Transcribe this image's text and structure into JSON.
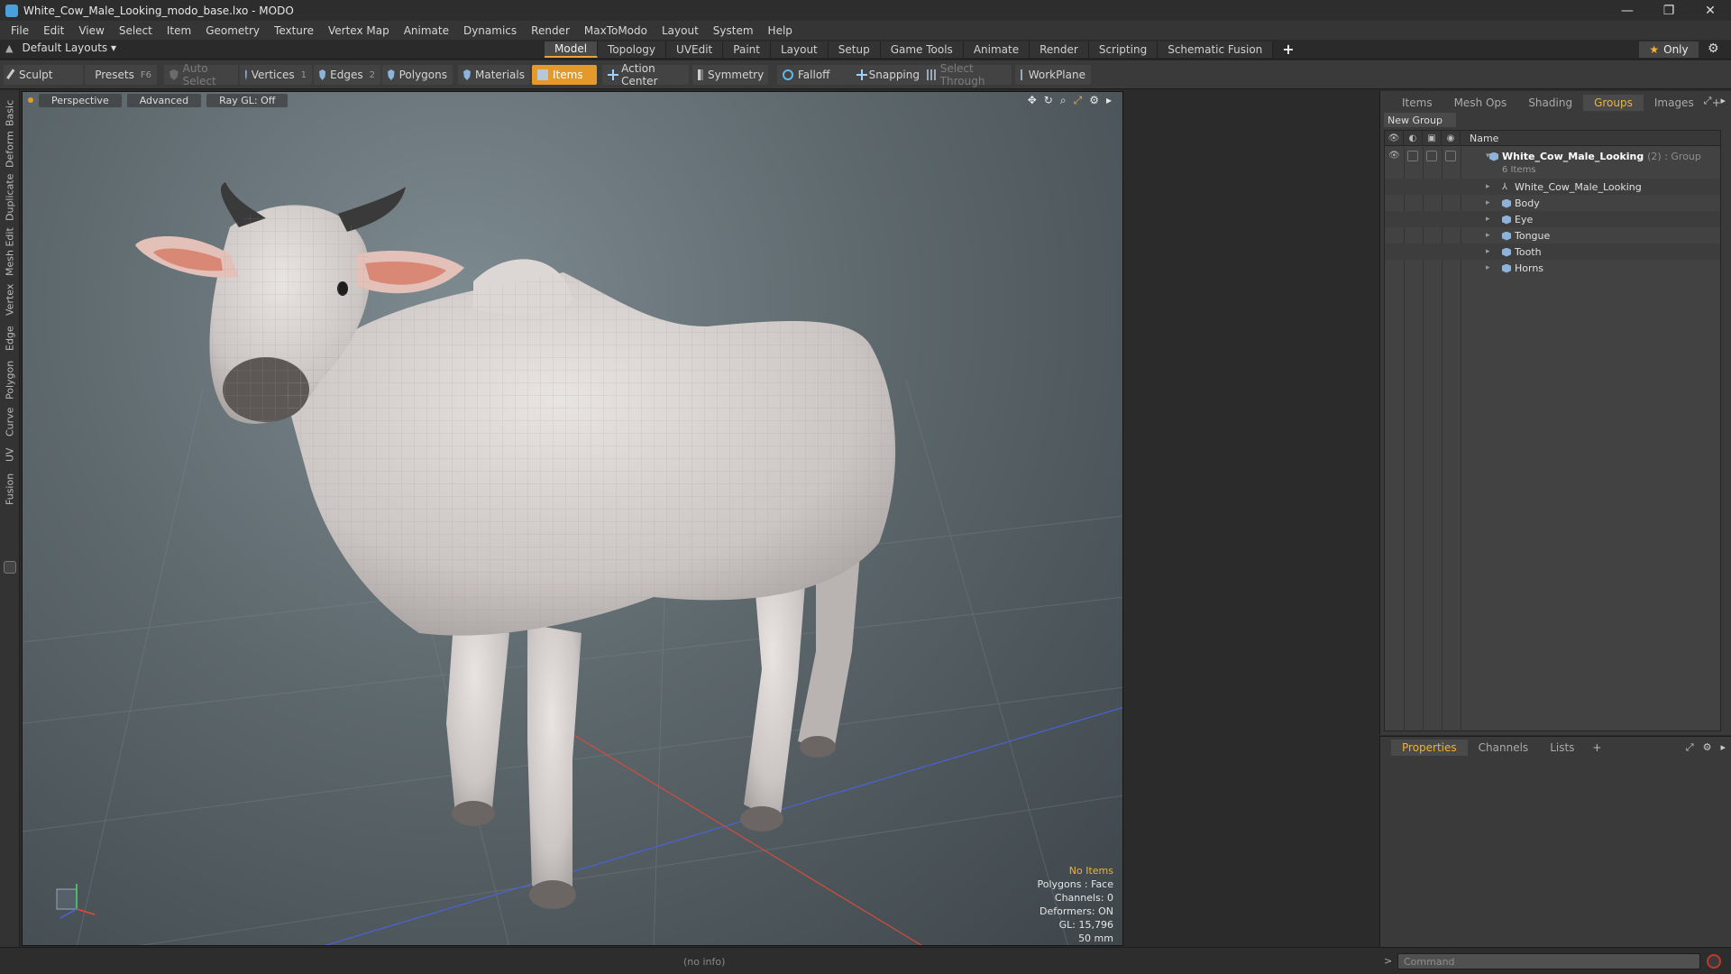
{
  "window": {
    "title": "White_Cow_Male_Looking_modo_base.lxo - MODO",
    "minimize": "—",
    "restore": "❐",
    "close": "✕"
  },
  "menu": [
    "File",
    "Edit",
    "View",
    "Select",
    "Item",
    "Geometry",
    "Texture",
    "Vertex Map",
    "Animate",
    "Dynamics",
    "Render",
    "MaxToModo",
    "Layout",
    "System",
    "Help"
  ],
  "layoutbar": {
    "layout_selector": "Default Layouts ▾",
    "tabs": [
      "Model",
      "Topology",
      "UVEdit",
      "Paint",
      "Layout",
      "Setup",
      "Game Tools",
      "Animate",
      "Render",
      "Scripting",
      "Schematic Fusion"
    ],
    "active_tab": "Model",
    "plus": "+",
    "only_label": "Only"
  },
  "toolbar": {
    "sculpt": "Sculpt",
    "presets": "Presets",
    "presets_key": "F6",
    "auto_select": "Auto Select",
    "vertices": "Vertices",
    "vertices_badge": "1",
    "edges": "Edges",
    "edges_badge": "2",
    "polygons": "Polygons",
    "materials": "Materials",
    "items": "Items",
    "action_center": "Action Center",
    "symmetry": "Symmetry",
    "falloff": "Falloff",
    "snapping": "Snapping",
    "select_through": "Select Through",
    "workplane": "WorkPlane"
  },
  "left_tabs": [
    "Basic",
    "Deform",
    "Duplicate",
    "Mesh Edit",
    "Vertex",
    "Edge",
    "Polygon",
    "Curve",
    "UV",
    "Fusion"
  ],
  "viewport": {
    "view_mode": "Perspective",
    "shading": "Advanced",
    "raygl": "Ray GL: Off",
    "info": {
      "selection": "No Items",
      "polygons": "Polygons : Face",
      "channels": "Channels: 0",
      "deformers": "Deformers: ON",
      "gl": "GL: 15,796",
      "focal": "50 mm"
    }
  },
  "groups_panel": {
    "tabs": [
      "Items",
      "Mesh Ops",
      "Shading",
      "Groups",
      "Images"
    ],
    "active_tab": "Groups",
    "new_group": "New Group",
    "name_header": "Name",
    "group": {
      "name": "White_Cow_Male_Looking",
      "suffix": "(2) : Group",
      "count": "6 Items"
    },
    "items": [
      "White_Cow_Male_Looking",
      "Body",
      "Eye",
      "Tongue",
      "Tooth",
      "Horns"
    ]
  },
  "properties_panel": {
    "tabs": [
      "Properties",
      "Channels",
      "Lists"
    ],
    "active_tab": "Properties"
  },
  "statusbar": {
    "info": "(no info)",
    "command_placeholder": "Command"
  },
  "colors": {
    "accent": "#e39a2b",
    "highlight_text": "#f2b233"
  }
}
